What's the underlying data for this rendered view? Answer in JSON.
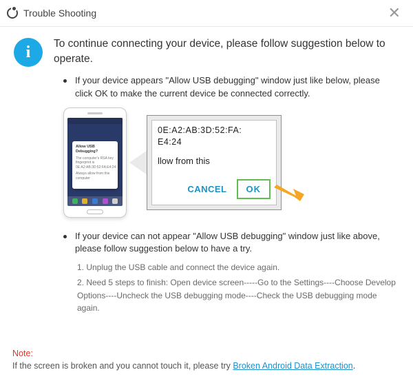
{
  "title": "Trouble Shooting",
  "info_glyph": "i",
  "headline": "To continue connecting your device, please follow suggestion below to operate.",
  "item1": "If your device appears \"Allow USB debugging\" window just like below, please click OK to make the current device  be connected correctly.",
  "item2": "If your device can not appear \"Allow USB debugging\" window just like above, please follow suggestion below to have a try.",
  "step1": "1. Unplug the USB cable and connect the device again.",
  "step2": "2. Need 5 steps to finish: Open device screen-----Go to the Settings----Choose Develop Options----Uncheck the USB debugging mode----Check the USB debugging mode again.",
  "note_label": "Note:",
  "note_text": "If the screen is broken and you cannot touch it, please try ",
  "note_link": "Broken Android Data Extraction",
  "note_tail": ".",
  "phone": {
    "popup_title": "Allow USB Debugging?",
    "popup_body": "The computer's RSA key fingerprint is",
    "popup_mac": "0E:A2:AB:3D:52:FA:E4:24",
    "popup_check": "Always allow from this computer"
  },
  "zoom": {
    "mac1": "0E:A2:AB:3D:52:FA:",
    "mac2": "E4:24",
    "allow_text": "llow from this",
    "cancel": "CANCEL",
    "ok": "OK"
  }
}
